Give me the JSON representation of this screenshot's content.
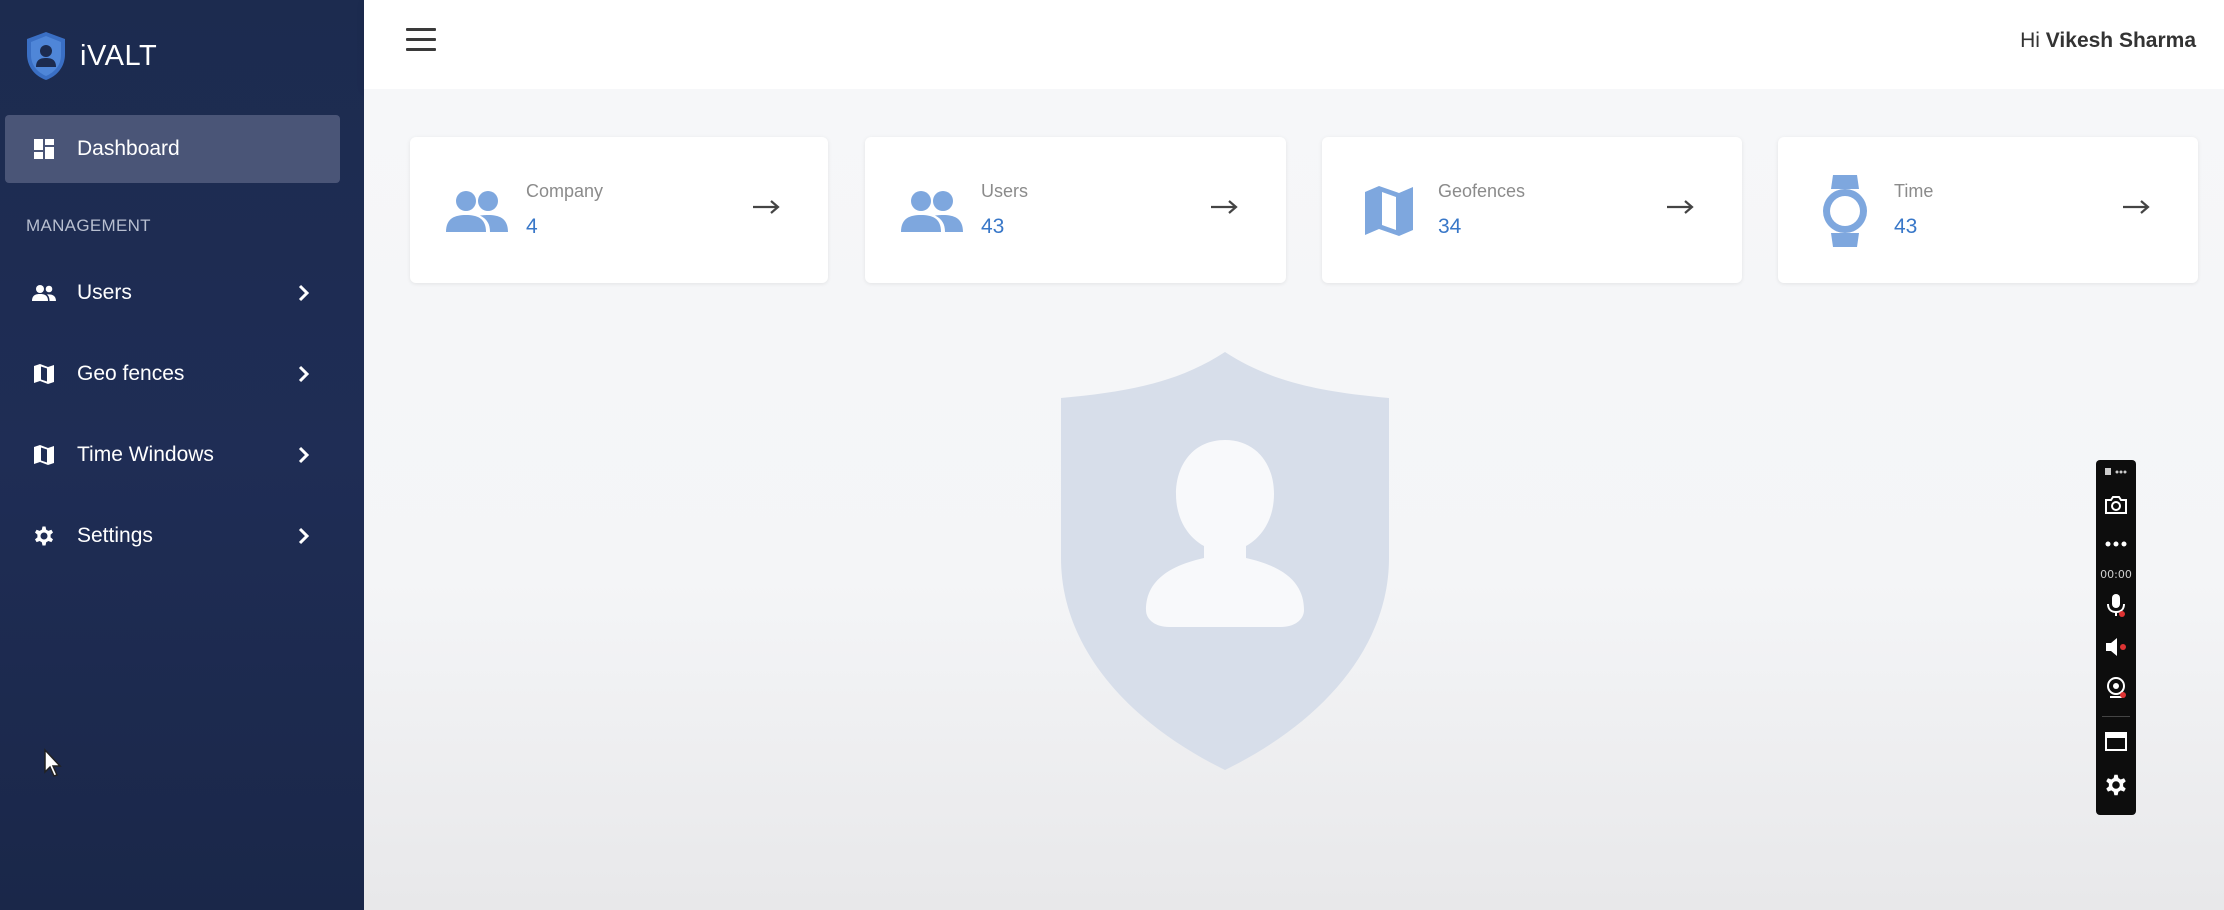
{
  "app": {
    "name": "iVALT"
  },
  "sidebar": {
    "items": [
      {
        "label": "Dashboard",
        "icon": "dashboard-icon",
        "active": true
      }
    ],
    "section_heading": "MANAGEMENT",
    "management_items": [
      {
        "label": "Users",
        "icon": "users-icon"
      },
      {
        "label": "Geo fences",
        "icon": "map-icon"
      },
      {
        "label": "Time Windows",
        "icon": "map-icon"
      },
      {
        "label": "Settings",
        "icon": "gear-icon"
      }
    ]
  },
  "header": {
    "greeting_prefix": "Hi",
    "user_name": "Vikesh Sharma"
  },
  "cards": [
    {
      "label": "Company",
      "value": "4",
      "icon": "people-icon"
    },
    {
      "label": "Users",
      "value": "43",
      "icon": "people-icon"
    },
    {
      "label": "Geofences",
      "value": "34",
      "icon": "map-icon"
    },
    {
      "label": "Time",
      "value": "43",
      "icon": "watch-icon"
    }
  ],
  "recorder": {
    "timer": "00:00"
  },
  "colors": {
    "sidebar_bg": "#1c2b4f",
    "active_item_bg": "#4a5577",
    "accent": "#3877c8",
    "card_icon": "#7ea7de"
  }
}
